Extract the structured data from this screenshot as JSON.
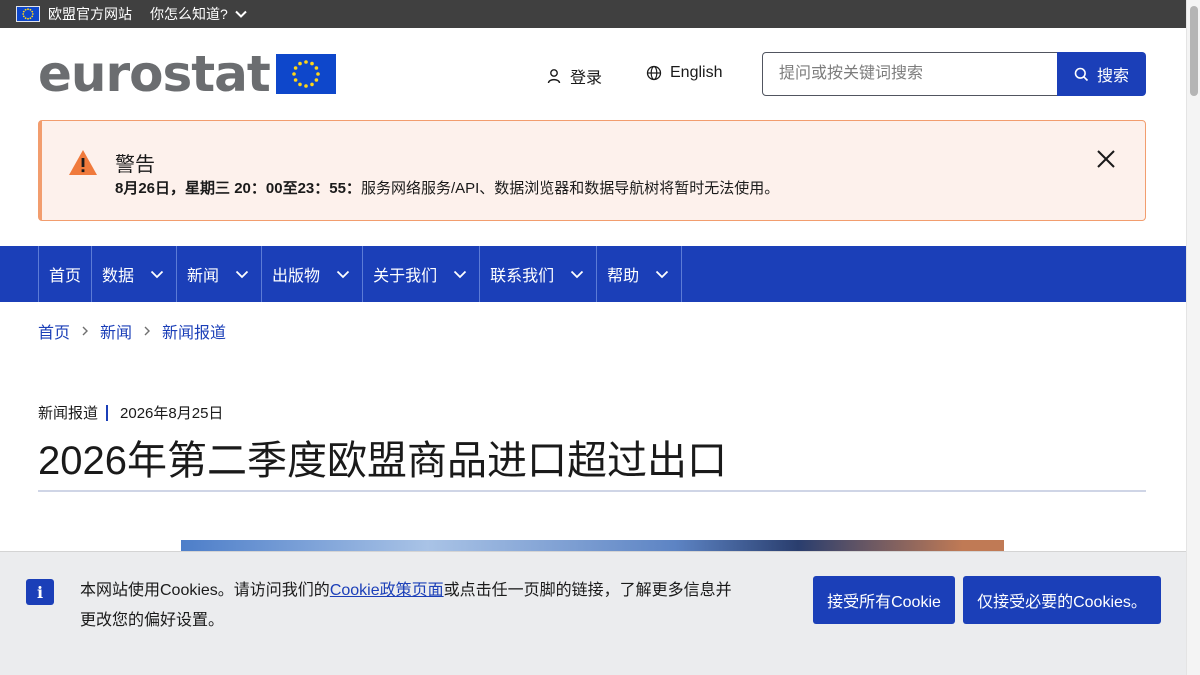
{
  "topbar": {
    "site_name": "欧盟官方网站",
    "how_label": "你怎么知道?"
  },
  "header": {
    "logo_text": "eurostat",
    "login_label": "登录",
    "language_label": "English",
    "search_placeholder": "提问或按关键词搜索",
    "search_button": "搜索"
  },
  "alert": {
    "title": "警告",
    "message_bold": "8月26日，星期三 20：00至23：55：",
    "message": "服务网络服务/API、数据浏览器和数据导航树将暂时无法使用。"
  },
  "nav": {
    "items": [
      {
        "label": "首页",
        "has_dropdown": false
      },
      {
        "label": "数据",
        "has_dropdown": true
      },
      {
        "label": "新闻",
        "has_dropdown": true
      },
      {
        "label": "出版物",
        "has_dropdown": true
      },
      {
        "label": "关于我们",
        "has_dropdown": true
      },
      {
        "label": "联系我们",
        "has_dropdown": true
      },
      {
        "label": "帮助",
        "has_dropdown": true
      }
    ]
  },
  "breadcrumb": [
    "首页",
    "新闻",
    "新闻报道"
  ],
  "article": {
    "type": "新闻报道",
    "date": "2026年8月25日",
    "title": "2026年第二季度欧盟商品进口超过出口"
  },
  "cookie": {
    "text_before": "本网站使用Cookies。请访问我们的",
    "link": "Cookie政策页面",
    "text_after": "或点击任一页脚的链接，了解更多信息并更改您的偏好设置。",
    "accept_all": "接受所有Cookie",
    "accept_necessary": "仅接受必要的Cookies。"
  },
  "colors": {
    "primary": "#1b3fb8",
    "topbar": "#404040",
    "alert_bg": "#fdf1ec",
    "alert_border": "#f29d6e"
  }
}
